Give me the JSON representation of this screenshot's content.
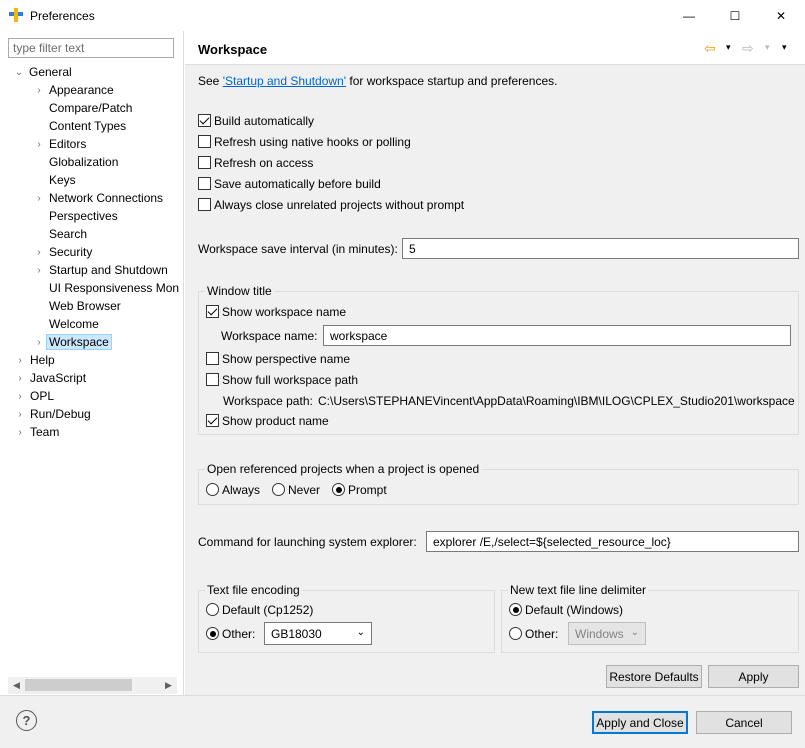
{
  "window": {
    "title": "Preferences",
    "minimize_glyph": "—",
    "maximize_glyph": "☐",
    "close_glyph": "✕"
  },
  "filter": {
    "placeholder": "type filter text"
  },
  "tree": {
    "general": "General",
    "appearance": "Appearance",
    "compare_patch": "Compare/Patch",
    "content_types": "Content Types",
    "editors": "Editors",
    "globalization": "Globalization",
    "keys": "Keys",
    "network_connections": "Network Connections",
    "perspectives": "Perspectives",
    "search": "Search",
    "security": "Security",
    "startup_shutdown": "Startup and Shutdown",
    "ui_responsiveness": "UI Responsiveness Mon",
    "web_browser": "Web Browser",
    "welcome": "Welcome",
    "workspace": "Workspace",
    "help": "Help",
    "javascript": "JavaScript",
    "opl": "OPL",
    "run_debug": "Run/Debug",
    "team": "Team",
    "expanded_glyph": "⌄",
    "collapsed_glyph": "›"
  },
  "page": {
    "title": "Workspace",
    "see_prefix": "See ",
    "see_link": "'Startup and Shutdown'",
    "see_suffix": " for workspace startup and preferences.",
    "build_automatically": "Build automatically",
    "refresh_native": "Refresh using native hooks or polling",
    "refresh_access": "Refresh on access",
    "save_before_build": "Save automatically before build",
    "always_close": "Always close unrelated projects without prompt",
    "save_interval_label": "Workspace save interval (in minutes):",
    "save_interval_value": "5",
    "window_title_group": "Window title",
    "show_workspace_name": "Show workspace name",
    "workspace_name_label": "Workspace name:",
    "workspace_name_value": "workspace",
    "show_perspective_name": "Show perspective name",
    "show_full_path": "Show full workspace path",
    "workspace_path_label": "Workspace path:",
    "workspace_path_value": "C:\\Users\\STEPHANEVincent\\AppData\\Roaming\\IBM\\ILOG\\CPLEX_Studio201\\workspace",
    "show_product_name": "Show product name",
    "open_ref_group": "Open referenced projects when a project is opened",
    "always": "Always",
    "never": "Never",
    "prompt": "Prompt",
    "cmd_label": "Command for launching system explorer:",
    "cmd_value": "explorer /E,/select=${selected_resource_loc}",
    "encoding_group": "Text file encoding",
    "default_encoding": "Default (Cp1252)",
    "other": "Other:",
    "encoding_value": "GB18030",
    "delimiter_group": "New text file line delimiter",
    "default_windows": "Default (Windows)",
    "delimiter_value": "Windows",
    "restore_defaults": "Restore Defaults",
    "apply": "Apply"
  },
  "footer": {
    "help": "?",
    "apply_close": "Apply and Close",
    "cancel": "Cancel"
  },
  "icons": {
    "back": "⇦",
    "forward": "⇨",
    "dropdown": "▾",
    "menu": "▾",
    "chevron": "⌄"
  },
  "colors": {
    "accent": "#0078d7",
    "link": "#0066cc",
    "selection": "#cce8ff",
    "nav_back": "#e8a317"
  }
}
